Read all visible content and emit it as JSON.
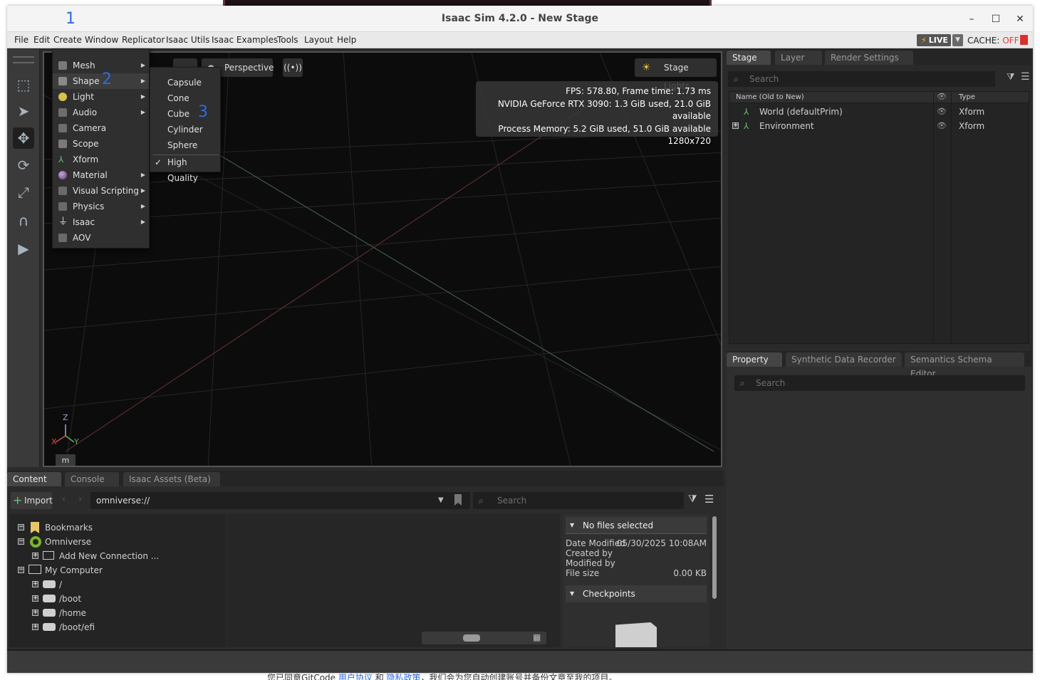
{
  "window": {
    "title": "Isaac Sim 4.2.0 - New Stage",
    "controls": [
      "–",
      "☐",
      "✕"
    ]
  },
  "markers": [
    "1",
    "2",
    "3"
  ],
  "menubar": {
    "items": [
      "File",
      "Edit",
      "Create",
      "Window",
      "Replicator",
      "Isaac Utils",
      "Isaac Examples",
      "Tools",
      "Layout",
      "Help"
    ],
    "live_label": "LIVE",
    "cache_label": "CACHE:",
    "cache_state": "OFF"
  },
  "create_menu": {
    "items": [
      {
        "label": "Mesh",
        "icon": "mesh-icon",
        "submenu": true
      },
      {
        "label": "Shape",
        "icon": "shape-icon",
        "submenu": true
      },
      {
        "label": "Light",
        "icon": "light-icon",
        "submenu": true
      },
      {
        "label": "Audio",
        "icon": "audio-icon",
        "submenu": true
      },
      {
        "label": "Camera",
        "icon": "camera-icon",
        "submenu": false
      },
      {
        "label": "Scope",
        "icon": "folder-icon",
        "submenu": false
      },
      {
        "label": "Xform",
        "icon": "xform-icon",
        "submenu": false
      },
      {
        "label": "Material",
        "icon": "material-sphere-icon",
        "submenu": true
      },
      {
        "label": "Visual Scripting",
        "icon": "graph-icon",
        "submenu": true
      },
      {
        "label": "Physics",
        "icon": "physics-icon",
        "submenu": true
      },
      {
        "label": "Isaac",
        "icon": "plug-icon",
        "submenu": true
      },
      {
        "label": "AOV",
        "icon": "image-icon",
        "submenu": false
      }
    ]
  },
  "shape_submenu": {
    "items": [
      "Capsule",
      "Cone",
      "Cube",
      "Cylinder",
      "Sphere"
    ],
    "check_item": "High Quality",
    "check_state": "✓"
  },
  "viewport": {
    "camera_label": "Perspective",
    "stage_lights_label": "Stage Lights",
    "stats": [
      "FPS: 578.80, Frame time: 1.73 ms",
      "NVIDIA GeForce RTX 3090: 1.3 GiB used, 21.0 GiB available",
      "Process Memory: 5.2 GiB used, 51.0 GiB available",
      "1280x720"
    ],
    "axis": {
      "z": "Z",
      "x": "X",
      "y": "Y"
    },
    "unit": "m"
  },
  "stage_panel": {
    "tabs": [
      "Stage",
      "Layer",
      "Render Settings"
    ],
    "search_placeholder": "Search",
    "col_name": "Name (Old to New)",
    "col_type": "Type",
    "rows": [
      {
        "name": "World (defaultPrim)",
        "type": "Xform"
      },
      {
        "name": "Environment",
        "type": "Xform"
      }
    ]
  },
  "property_panel": {
    "tabs": [
      "Property",
      "Synthetic Data Recorder",
      "Semantics Schema Editor"
    ],
    "search_placeholder": "Search"
  },
  "content_panel": {
    "tabs": [
      "Content",
      "Console",
      "Isaac Assets (Beta)"
    ],
    "import_label": "Import",
    "path": "omniverse://",
    "search_placeholder": "Search",
    "tree": [
      {
        "label": "Bookmarks",
        "indent": 0,
        "toggle": "minus",
        "icon": "bookmark-icon"
      },
      {
        "label": "Omniverse",
        "indent": 0,
        "toggle": "minus",
        "icon": "omniverse-icon"
      },
      {
        "label": "Add New Connection ...",
        "indent": 1,
        "toggle": "plus",
        "icon": "add-connection-icon"
      },
      {
        "label": "My Computer",
        "indent": 0,
        "toggle": "minus",
        "icon": "computer-icon"
      },
      {
        "label": "/",
        "indent": 1,
        "toggle": "plus",
        "icon": "drive-icon"
      },
      {
        "label": "/boot",
        "indent": 1,
        "toggle": "plus",
        "icon": "drive-icon"
      },
      {
        "label": "/home",
        "indent": 1,
        "toggle": "plus",
        "icon": "drive-icon"
      },
      {
        "label": "/boot/efi",
        "indent": 1,
        "toggle": "plus",
        "icon": "drive-icon"
      }
    ],
    "details": {
      "header": "No files selected",
      "date_modified_label": "Date Modified",
      "date_modified_value": "05/30/2025 10:08AM",
      "created_by_label": "Created by",
      "modified_by_label": "Modified by",
      "file_size_label": "File size",
      "file_size_value": "0.00 KB",
      "checkpoints_label": "Checkpoints"
    }
  },
  "footer": {
    "prefix": "您已同意GitCode ",
    "link1": "用户协议",
    "middle": " 和 ",
    "link2": "隐私政策",
    "suffix": "，我们会为您自动创建账号并备份文章至我的项目。"
  }
}
